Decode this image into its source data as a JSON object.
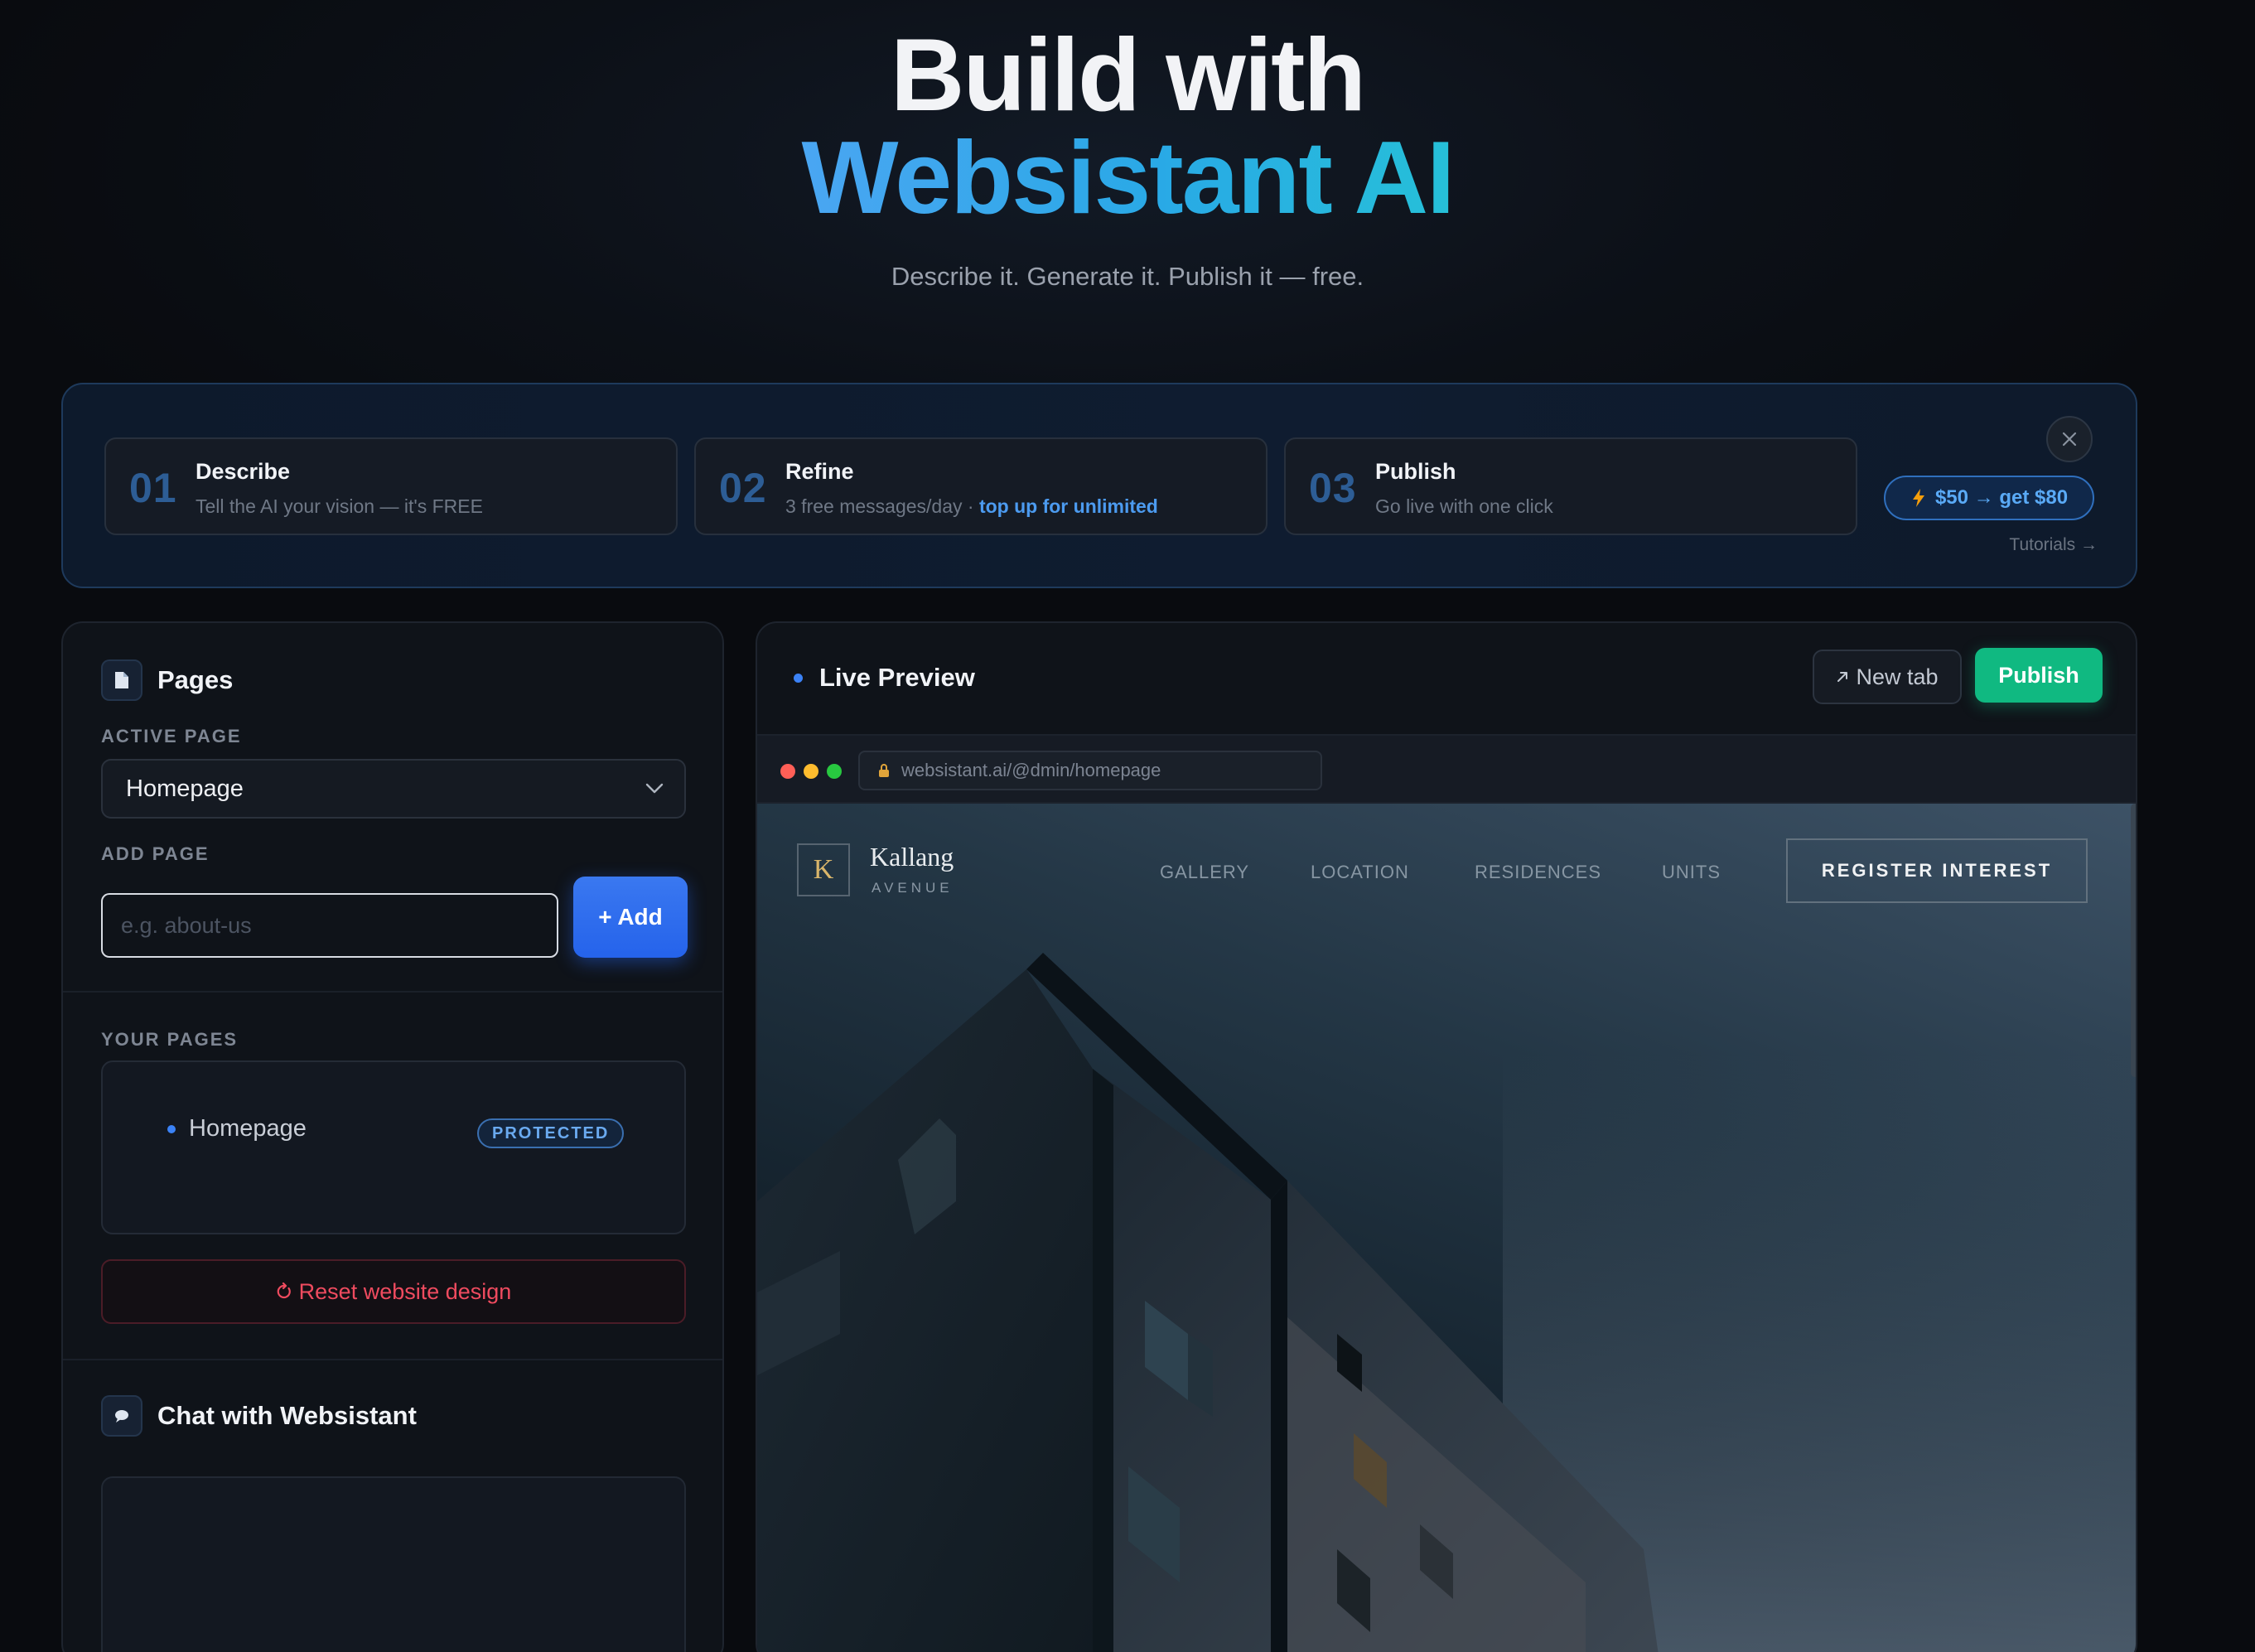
{
  "hero": {
    "line1": "Build with",
    "line2": "Websistant AI",
    "subtitle": "Describe it. Generate it. Publish it — free."
  },
  "steps": [
    {
      "num": "01",
      "title": "Describe",
      "desc": "Tell the AI your vision — it's FREE",
      "highlight": ""
    },
    {
      "num": "02",
      "title": "Refine",
      "desc": "3 free messages/day · ",
      "highlight": "top up for unlimited"
    },
    {
      "num": "03",
      "title": "Publish",
      "desc": "Go live with one click",
      "highlight": ""
    }
  ],
  "banner": {
    "close_icon": "close-icon",
    "promo_label": "$50 → get $80",
    "tutorials_label": "Tutorials →"
  },
  "left": {
    "pages_title": "Pages",
    "active_page_label": "ACTIVE PAGE",
    "active_page_value": "Homepage",
    "add_page_label": "ADD PAGE",
    "add_page_placeholder": "e.g. about-us",
    "add_button": "+ Add",
    "your_pages_label": "YOUR PAGES",
    "pages": [
      {
        "name": "Homepage",
        "badge": "PROTECTED"
      }
    ],
    "reset_button": "Reset website design",
    "chat_title": "Chat with Websistant"
  },
  "preview": {
    "title": "Live Preview",
    "new_tab_button": "New tab",
    "publish_button": "Publish",
    "url": "websistant.ai/@dmin/homepage",
    "site": {
      "logo_letter": "K",
      "name": "Kallang",
      "subname": "AVENUE",
      "nav": [
        "GALLERY",
        "LOCATION",
        "RESIDENCES",
        "UNITS"
      ],
      "cta": "REGISTER INTEREST"
    }
  },
  "colors": {
    "accent_blue": "#2563eb",
    "publish_green": "#10b981",
    "danger_red": "#ef4b5f",
    "traffic_red": "#ff5f57",
    "traffic_yellow": "#febc2e",
    "traffic_green": "#28c840"
  }
}
